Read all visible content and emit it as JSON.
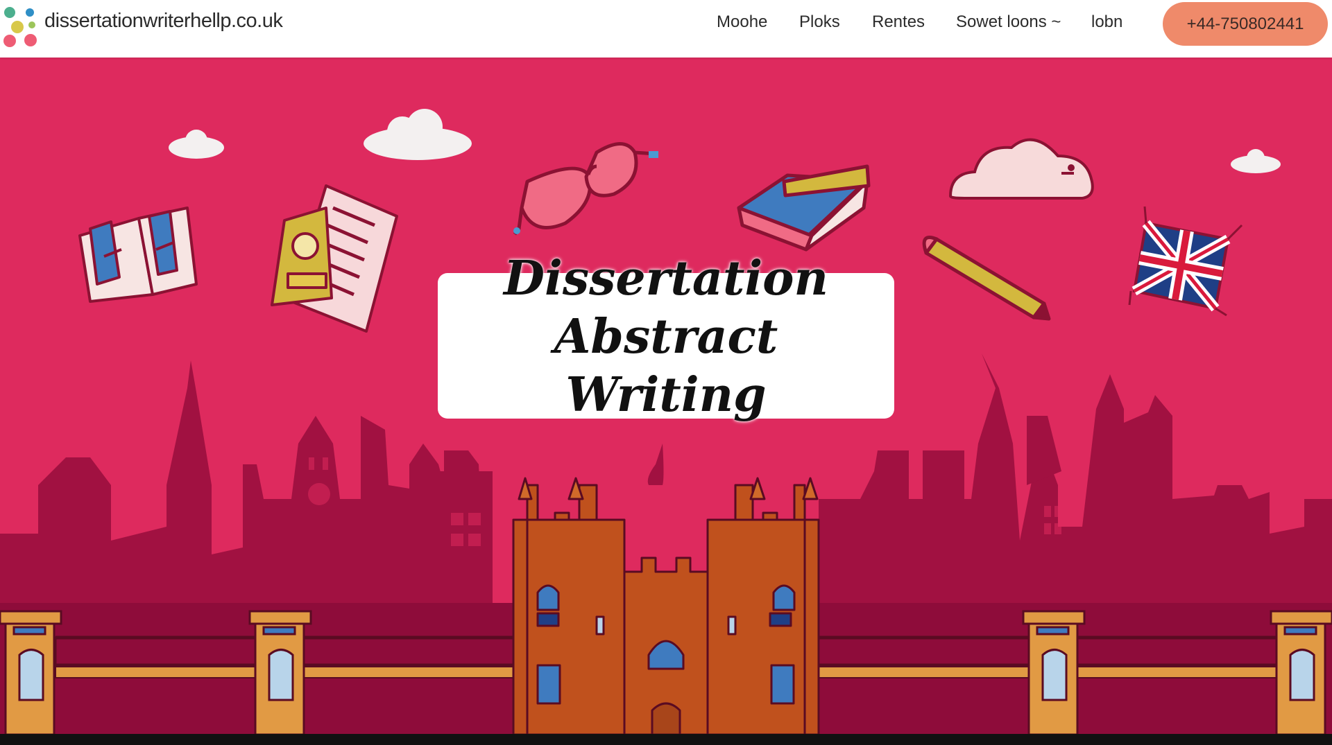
{
  "site": {
    "logo_text": "dissertationwriterhellp.co.uk"
  },
  "nav": {
    "items": [
      {
        "label": "Moohe"
      },
      {
        "label": "Ploks"
      },
      {
        "label": "Rentes"
      },
      {
        "label": "Sowet loons ~"
      },
      {
        "label": "lobn"
      }
    ],
    "phone_label": "+44-750802441"
  },
  "hero": {
    "title_lines": [
      "Dissertation",
      "Abstract",
      "Writing"
    ]
  },
  "colors": {
    "hero_bg": "#de2a5e",
    "skyline": "#a11141",
    "castle": "#c0511d",
    "phone_button": "#ef8a6a"
  },
  "icons": [
    "open-book-icon",
    "document-icon",
    "glasses-icon",
    "graduation-cap-icon",
    "pencil-icon",
    "union-jack-flag-icon",
    "cloud-icon",
    "castle-illustration",
    "city-skyline-illustration"
  ]
}
